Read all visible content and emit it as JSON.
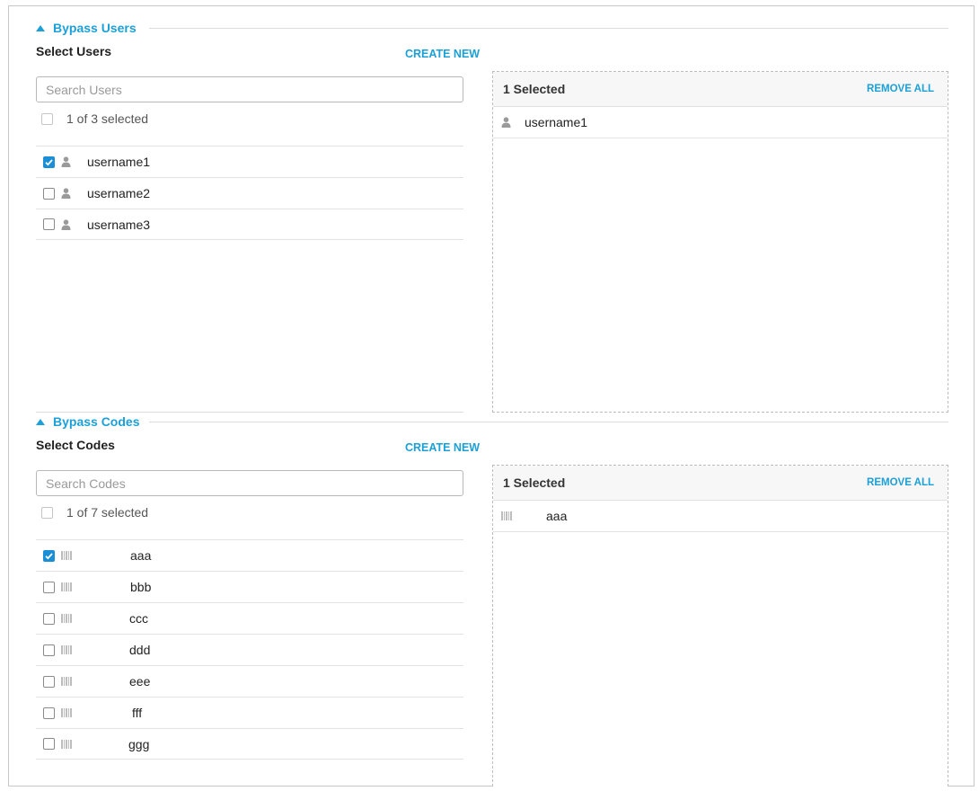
{
  "users_section": {
    "title": "Bypass Users",
    "subtitle": "Select Users",
    "create_new": "CREATE NEW",
    "search_placeholder": "Search Users",
    "selected_summary": "1 of 3 selected",
    "items": [
      {
        "label": "username1",
        "checked": true
      },
      {
        "label": "username2",
        "checked": false
      },
      {
        "label": "username3",
        "checked": false
      }
    ],
    "panel": {
      "count_label": "1 Selected",
      "remove_all": "REMOVE ALL",
      "items": [
        {
          "label": "username1"
        }
      ]
    }
  },
  "codes_section": {
    "title": "Bypass Codes",
    "subtitle": "Select Codes",
    "create_new": "CREATE NEW",
    "search_placeholder": "Search Codes",
    "selected_summary": "1 of 7 selected",
    "items": [
      {
        "label": "aaa",
        "checked": true
      },
      {
        "label": "bbb",
        "checked": false
      },
      {
        "label": "ccc",
        "checked": false
      },
      {
        "label": "ddd",
        "checked": false
      },
      {
        "label": "eee",
        "checked": false
      },
      {
        "label": "fff",
        "checked": false
      },
      {
        "label": "ggg",
        "checked": false
      }
    ],
    "panel": {
      "count_label": "1 Selected",
      "remove_all": "REMOVE ALL",
      "items": [
        {
          "label": "aaa"
        }
      ]
    }
  },
  "icons": {
    "collapse": "triangle-up-icon",
    "user": "user-icon",
    "code": "barcode-icon",
    "checkbox": "checkmark-icon"
  },
  "colors": {
    "accent": "#1ba0d7",
    "checkbox_checked": "#1a8fd6",
    "icon_gray": "#9a9a9a"
  }
}
